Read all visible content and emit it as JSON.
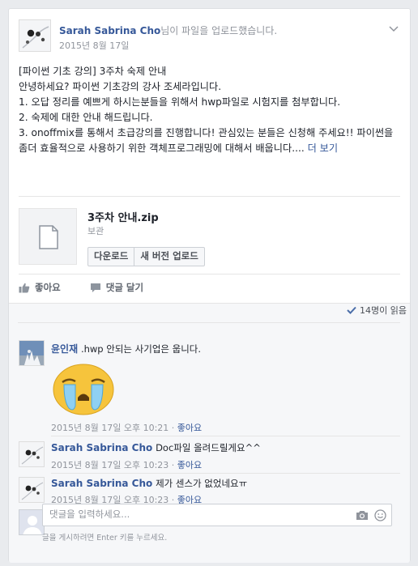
{
  "post": {
    "author": "Sarah Sabrina Cho",
    "action": "님이 파일을 업로드했습니다.",
    "date": "2015년 8월 17일",
    "body": "[파이썬 기초 강의] 3주차 숙제 안내\n안녕하세요? 파이썬 기초강의 강사 조세라입니다.\n1. 오답 정리를 예쁘게 하시는분들을 위해서 hwp파일로 시험지를 첨부합니다.\n2. 숙제에 대한 안내 해드립니다.\n3. onoffmix를 통해서 초급강의를 진행합니다! 관심있는 분들은 신청해 주세요!! 파이썬을 좀더 효율적으로 사용하기 위한 객체프로그래밍에 대해서 배웁니다.... ",
    "more": "더 보기"
  },
  "file": {
    "name": "3주차 안내.zip",
    "type": "보관",
    "download_label": "다운로드",
    "new_version_label": "새 버전 업로드"
  },
  "actions": {
    "like": "좋아요",
    "comment": "댓글 달기"
  },
  "seen": "14명이 읽음",
  "comments": [
    {
      "name": "윤인재",
      "text": ".hwp 안되는 사기업은 웁니다.",
      "time": "2015년 8월 17일 오후 10:21",
      "like": "좋아요"
    },
    {
      "name": "Sarah Sabrina Cho",
      "text": "Doc파일 올려드릴게요^^",
      "time": "2015년 8월 17일 오후 10:23",
      "like": "좋아요"
    },
    {
      "name": "Sarah Sabrina Cho",
      "text": "제가 센스가 없었네요ㅠ",
      "time": "2015년 8월 17일 오후 10:23",
      "like": "좋아요"
    }
  ],
  "composer": {
    "placeholder": "댓글을 입력하세요...",
    "hint": "글을 게시하려면 Enter 키를 누르세요."
  },
  "colors": {
    "link": "#365899",
    "muted": "#90949c",
    "background": "#e9ebee"
  },
  "icons": [
    "chevron-down-icon",
    "file-icon",
    "thumbs-up-icon",
    "comment-icon",
    "check-icon",
    "crying-emoji-icon",
    "camera-icon",
    "emoji-icon"
  ]
}
